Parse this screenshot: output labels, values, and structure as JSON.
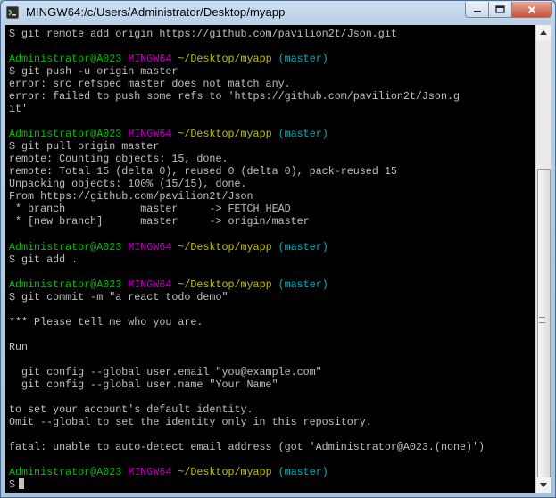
{
  "window": {
    "title": "MINGW64:/c/Users/Administrator/Desktop/myapp",
    "icon": "mingw-terminal-icon",
    "controls": {
      "minimize": "minimize-icon",
      "maximize": "maximize-icon",
      "close": "close-icon"
    }
  },
  "prompt": {
    "user_host": "Administrator@A023",
    "shell": "MINGW64",
    "path": "~/Desktop/myapp",
    "branch": "(master)"
  },
  "colors": {
    "user_host": "#00c000",
    "shell": "#c000c0",
    "path": "#c0c000",
    "branch": "#00b0c0",
    "text": "#c0c0c0",
    "background": "#000000"
  },
  "terminal": {
    "lines": [
      {
        "type": "text",
        "text": "$ git remote add origin https://github.com/pavilion2t/Json.git"
      },
      {
        "type": "blank"
      },
      {
        "type": "prompt"
      },
      {
        "type": "text",
        "text": "$ git push -u origin master"
      },
      {
        "type": "text",
        "text": "error: src refspec master does not match any."
      },
      {
        "type": "text",
        "text": "error: failed to push some refs to 'https://github.com/pavilion2t/Json.g"
      },
      {
        "type": "text",
        "text": "it'"
      },
      {
        "type": "blank"
      },
      {
        "type": "prompt"
      },
      {
        "type": "text",
        "text": "$ git pull origin master"
      },
      {
        "type": "text",
        "text": "remote: Counting objects: 15, done."
      },
      {
        "type": "text",
        "text": "remote: Total 15 (delta 0), reused 0 (delta 0), pack-reused 15"
      },
      {
        "type": "text",
        "text": "Unpacking objects: 100% (15/15), done."
      },
      {
        "type": "text",
        "text": "From https://github.com/pavilion2t/Json"
      },
      {
        "type": "text",
        "text": " * branch            master     -> FETCH_HEAD"
      },
      {
        "type": "text",
        "text": " * [new branch]      master     -> origin/master"
      },
      {
        "type": "blank"
      },
      {
        "type": "prompt"
      },
      {
        "type": "text",
        "text": "$ git add ."
      },
      {
        "type": "blank"
      },
      {
        "type": "prompt"
      },
      {
        "type": "text",
        "text": "$ git commit -m \"a react todo demo\""
      },
      {
        "type": "blank"
      },
      {
        "type": "text",
        "text": "*** Please tell me who you are."
      },
      {
        "type": "blank"
      },
      {
        "type": "text",
        "text": "Run"
      },
      {
        "type": "blank"
      },
      {
        "type": "text",
        "text": "  git config --global user.email \"you@example.com\""
      },
      {
        "type": "text",
        "text": "  git config --global user.name \"Your Name\""
      },
      {
        "type": "blank"
      },
      {
        "type": "text",
        "text": "to set your account's default identity."
      },
      {
        "type": "text",
        "text": "Omit --global to set the identity only in this repository."
      },
      {
        "type": "blank"
      },
      {
        "type": "text",
        "text": "fatal: unable to auto-detect email address (got 'Administrator@A023.(none)')"
      },
      {
        "type": "blank"
      },
      {
        "type": "prompt"
      },
      {
        "type": "input",
        "text": "$"
      }
    ]
  },
  "scrollbar": {
    "up": "scroll-up-arrow-icon",
    "down": "scroll-down-arrow-icon"
  }
}
